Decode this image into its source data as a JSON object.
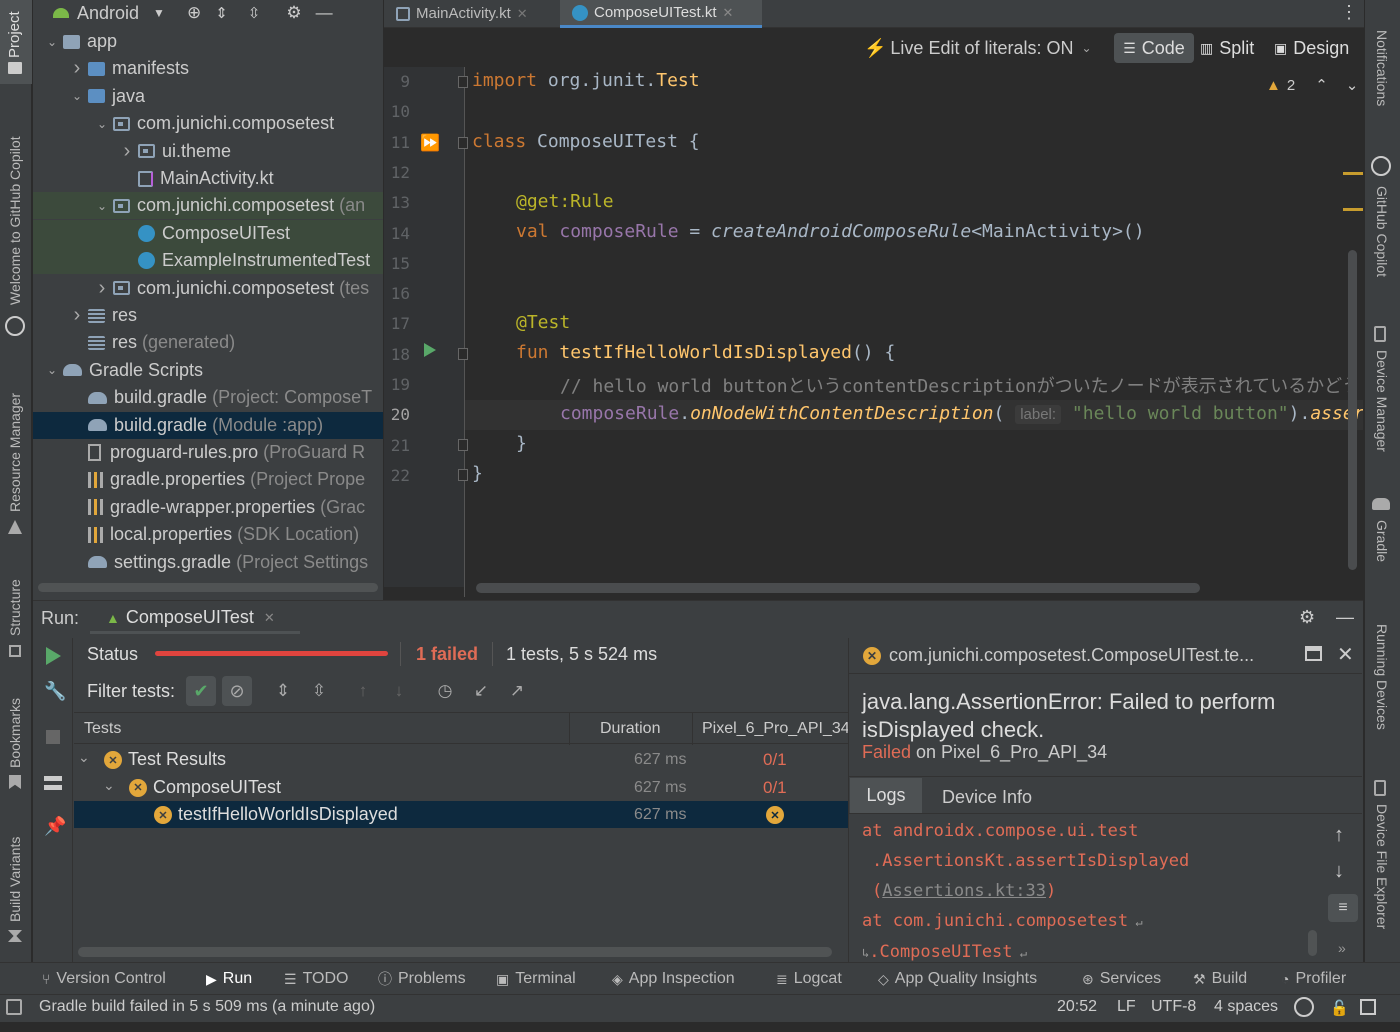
{
  "project_panel": {
    "view_selector": "Android",
    "tree": [
      {
        "label": "app",
        "grey": "",
        "kind": "module",
        "indent": 0,
        "arrow": "open"
      },
      {
        "label": "manifests",
        "grey": "",
        "kind": "folder",
        "indent": 1,
        "arrow": "closed"
      },
      {
        "label": "java",
        "grey": "",
        "kind": "folder",
        "indent": 1,
        "arrow": "open"
      },
      {
        "label": "com.junichi.composetest",
        "grey": "",
        "kind": "package",
        "indent": 2,
        "arrow": "open"
      },
      {
        "label": "ui.theme",
        "grey": "",
        "kind": "package",
        "indent": 3,
        "arrow": "closed"
      },
      {
        "label": "MainActivity.kt",
        "grey": "",
        "kind": "kotlin",
        "indent": 3,
        "arrow": "none"
      },
      {
        "label": "com.junichi.composetest",
        "grey": "(an",
        "kind": "package",
        "indent": 2,
        "arrow": "open"
      },
      {
        "label": "ComposeUITest",
        "grey": "",
        "kind": "testclass",
        "indent": 3,
        "arrow": "none"
      },
      {
        "label": "ExampleInstrumentedTest",
        "grey": "",
        "kind": "testclass",
        "indent": 3,
        "arrow": "none"
      },
      {
        "label": "com.junichi.composetest",
        "grey": "(tes",
        "kind": "package",
        "indent": 2,
        "arrow": "closed"
      },
      {
        "label": "res",
        "grey": "",
        "kind": "res",
        "indent": 1,
        "arrow": "closed"
      },
      {
        "label": "res",
        "grey": "(generated)",
        "kind": "res",
        "indent": 1,
        "arrow": "none"
      },
      {
        "label": "Gradle Scripts",
        "grey": "",
        "kind": "gradle",
        "indent": 0,
        "arrow": "open"
      },
      {
        "label": "build.gradle",
        "grey": "(Project: ComposeT",
        "kind": "gradle",
        "indent": 1,
        "arrow": "none"
      },
      {
        "label": "build.gradle",
        "grey": "(Module :app)",
        "kind": "gradle",
        "indent": 1,
        "arrow": "none"
      },
      {
        "label": "proguard-rules.pro",
        "grey": "(ProGuard R",
        "kind": "file",
        "indent": 1,
        "arrow": "none"
      },
      {
        "label": "gradle.properties",
        "grey": "(Project Prope",
        "kind": "props",
        "indent": 1,
        "arrow": "none"
      },
      {
        "label": "gradle-wrapper.properties",
        "grey": "(Grac",
        "kind": "props",
        "indent": 1,
        "arrow": "none"
      },
      {
        "label": "local.properties",
        "grey": "(SDK Location)",
        "kind": "props",
        "indent": 1,
        "arrow": "none"
      },
      {
        "label": "settings.gradle",
        "grey": "(Project Settings",
        "kind": "gradle",
        "indent": 1,
        "arrow": "none"
      }
    ]
  },
  "left_strip": [
    "Project",
    "Welcome to GitHub Copilot",
    "Resource Manager",
    "Structure",
    "Bookmarks",
    "Build Variants"
  ],
  "right_strip": [
    "Notifications",
    "GitHub Copilot",
    "Device Manager",
    "Gradle",
    "Running Devices",
    "Device File Explorer"
  ],
  "editor": {
    "tabs": [
      {
        "label": "MainActivity.kt",
        "active": false
      },
      {
        "label": "ComposeUITest.kt",
        "active": true
      }
    ],
    "live_edit": "Live Edit of literals: ON",
    "modes": [
      "Code",
      "Split",
      "Design"
    ],
    "warnings": "2",
    "line_numbers": [
      "9",
      "10",
      "11",
      "12",
      "13",
      "14",
      "15",
      "16",
      "17",
      "18",
      "19",
      "20",
      "21",
      "22"
    ],
    "code": {
      "l9_kw": "import",
      "l9_rest": " org.junit.",
      "l9_cls": "Test",
      "l11_kw": "class",
      "l11_rest": " ComposeUITest {",
      "l13_ann": "@get:Rule",
      "l14_kw": "val",
      "l14_prop": "composeRule",
      "l14_eq": " = ",
      "l14_call": "createAndroidComposeRule",
      "l14_rest": "<MainActivity>()",
      "l17_ann": "@Test",
      "l18_kw": "fun",
      "l18_fn": "testIfHelloWorldIsDisplayed",
      "l18_rest": "() {",
      "l19_comment": "// hello world buttonというcontentDescriptionがついたノードが表示されているかどう",
      "l20_prop": "composeRule",
      "l20_dot": ".",
      "l20_call": "onNodeWithContentDescription",
      "l20_paren": "(",
      "l20_hint": "label:",
      "l20_str": "\"hello world button\"",
      "l20_tail": ").",
      "l20_tail2": "asser",
      "l21": "}",
      "l22": "}"
    }
  },
  "run_panel": {
    "label": "Run:",
    "tab": "ComposeUITest",
    "status_label": "Status",
    "failed": "1 failed",
    "summary": "1 tests, 5 s 524 ms",
    "filter_label": "Filter tests:",
    "columns": [
      "Tests",
      "Duration",
      "Pixel_6_Pro_API_34"
    ],
    "rows": [
      {
        "name": "Test Results",
        "duration": "627 ms",
        "result": "0/1",
        "indent": 0,
        "selected": false
      },
      {
        "name": "ComposeUITest",
        "duration": "627 ms",
        "result": "0/1",
        "indent": 1,
        "selected": false
      },
      {
        "name": "testIfHelloWorldIsDisplayed",
        "duration": "627 ms",
        "result": "",
        "indent": 2,
        "selected": true
      }
    ],
    "detail": {
      "title": "com.junichi.composetest.ComposeUITest.te...",
      "error1": "java.lang.AssertionError: Failed to perform",
      "error2": "isDisplayed check.",
      "failed_word": "Failed",
      "failed_on": " on Pixel_6_Pro_API_34",
      "tabs": [
        "Logs",
        "Device Info"
      ],
      "log1": "at androidx.compose.ui.test",
      "log2": ".AssertionsKt.assertIsDisplayed",
      "log3_open": "(",
      "log3_link": "Assertions.kt:33",
      "log3_close": ")",
      "log4": "at com.junichi.composetest",
      "log5": ".ComposeUITest"
    }
  },
  "bottom_tools": [
    "Version Control",
    "Run",
    "TODO",
    "Problems",
    "Terminal",
    "App Inspection",
    "Logcat",
    "App Quality Insights",
    "Services",
    "Build",
    "Profiler"
  ],
  "status_bar": {
    "message": "Gradle build failed in 5 s 509 ms (a minute ago)",
    "position": "20:52",
    "line_sep": "LF",
    "encoding": "UTF-8",
    "indent": "4 spaces"
  },
  "colors": {
    "accent": "#3592c4",
    "error": "#e06c56",
    "selection": "#0d293e",
    "test_bg": "#3c4a3c"
  }
}
